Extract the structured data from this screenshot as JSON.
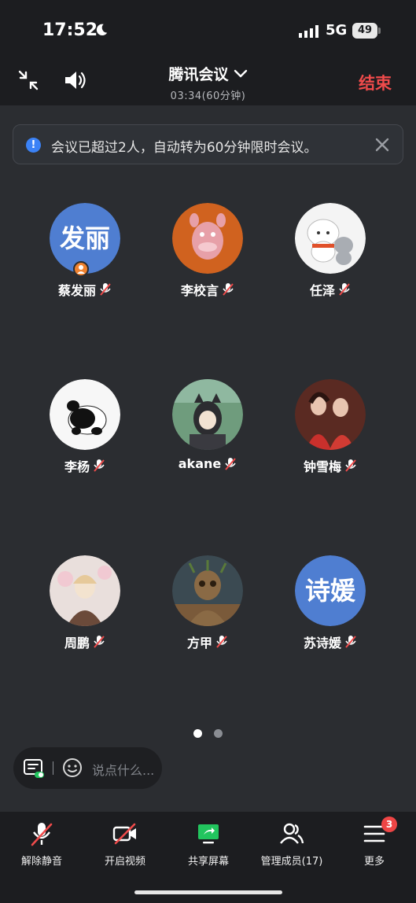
{
  "status_bar": {
    "time": "17:52",
    "network": "5G",
    "battery": "49"
  },
  "top_bar": {
    "title": "腾讯会议",
    "duration": "03:34(60分钟)",
    "end_label": "结束"
  },
  "notice": {
    "text": "会议已超过2人，自动转为60分钟限时会议。",
    "icon": "info-icon"
  },
  "members": [
    {
      "name": "蔡发丽",
      "avatar_text": "发丽",
      "host": true
    },
    {
      "name": "李校言",
      "avatar_text": ""
    },
    {
      "name": "任泽",
      "avatar_text": ""
    },
    {
      "name": "李杨",
      "avatar_text": ""
    },
    {
      "name": "akane",
      "avatar_text": ""
    },
    {
      "name": "钟雪梅",
      "avatar_text": ""
    },
    {
      "name": "周鹏",
      "avatar_text": ""
    },
    {
      "name": "方甲",
      "avatar_text": ""
    },
    {
      "name": "苏诗媛",
      "avatar_text": "诗媛"
    }
  ],
  "chat": {
    "placeholder": "说点什么..."
  },
  "toolbar": {
    "unmute": "解除静音",
    "video": "开启视频",
    "share": "共享屏幕",
    "members": "管理成员(17)",
    "more": "更多",
    "more_badge": "3"
  },
  "colors": {
    "end": "#f04b4b",
    "avatar_blue": "#4f7ed1",
    "share_green": "#22c55e",
    "badge_red": "#ee4545"
  }
}
